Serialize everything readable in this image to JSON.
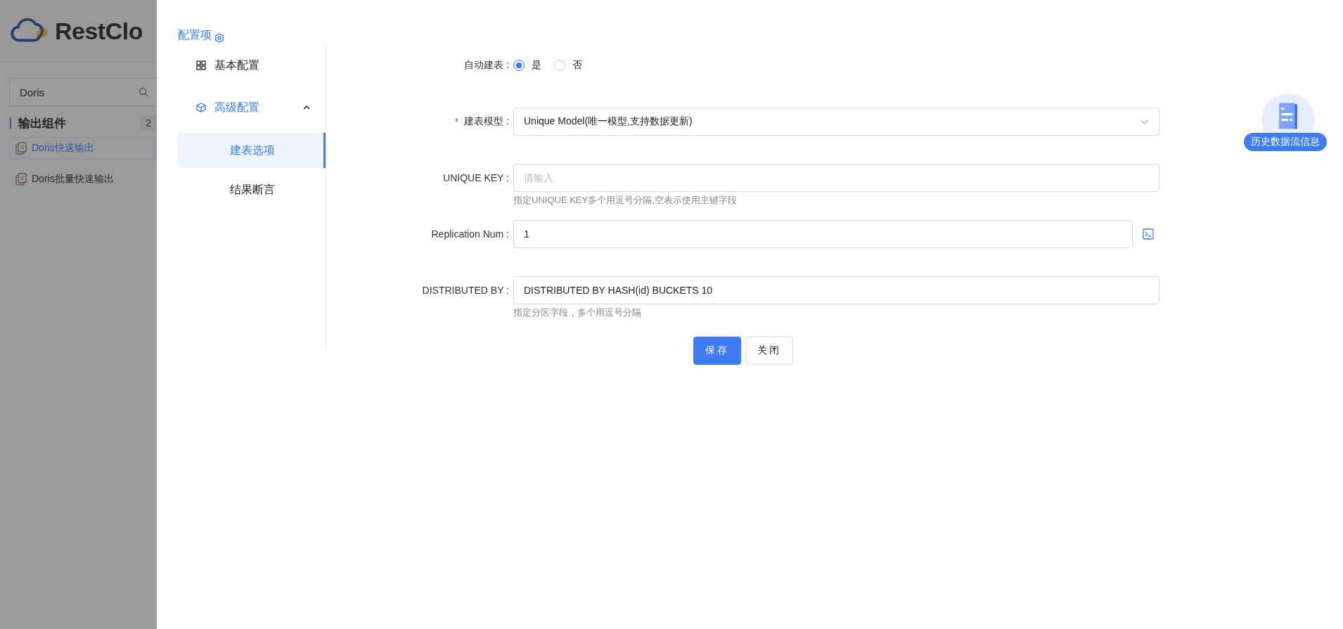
{
  "background": {
    "logo": "RestClo",
    "search": {
      "value": "Doris"
    },
    "section": {
      "title": "输出组件",
      "count": "2"
    },
    "components": [
      {
        "label": "Doris快速输出",
        "selected": true
      },
      {
        "label": "Doris批量快速输出",
        "selected": false
      }
    ]
  },
  "drawer": {
    "title": "配置项",
    "menu": [
      {
        "label": "基本配置",
        "kind": "grid",
        "selected": false
      },
      {
        "label": "高级配置",
        "kind": "cube",
        "selected": true,
        "expanded": true,
        "children": [
          {
            "label": "建表选项",
            "selected": true
          },
          {
            "label": "结果断言",
            "selected": false
          }
        ]
      }
    ],
    "form": [
      {
        "kind": "radio",
        "label": "自动建表 :",
        "options": [
          {
            "label": "是",
            "selected": true
          },
          {
            "label": "否",
            "selected": false
          }
        ]
      },
      {
        "kind": "select",
        "mark": "*",
        "label": "建表模型 :",
        "value": "Unique Model(唯一模型,支持数据更新)"
      },
      {
        "kind": "input",
        "label": "UNIQUE KEY :",
        "placeholder": "请输入",
        "hint": "指定UNIQUE KEY多个用逗号分隔,空表示使用主键字段"
      },
      {
        "kind": "input",
        "label": "Replication Num :",
        "value": "1",
        "action": true
      },
      {
        "kind": "input",
        "label": "DISTRIBUTED BY :",
        "value": "DISTRIBUTED BY HASH(id) BUCKETS 10",
        "hint": "指定分区字段，多个用逗号分隔"
      }
    ],
    "buttons": [
      {
        "label": "保存",
        "primary": true
      },
      {
        "label": "关闭",
        "primary": false
      }
    ]
  },
  "history": {
    "label": "历史数据流信息"
  }
}
